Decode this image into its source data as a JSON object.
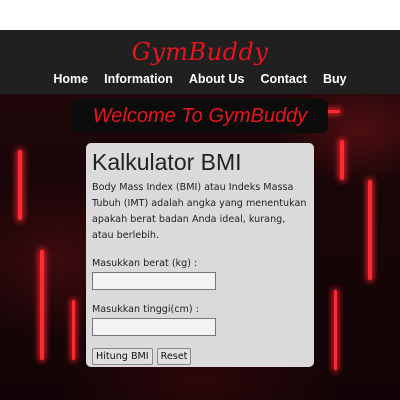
{
  "brand": "GymBuddy",
  "nav": [
    "Home",
    "Information",
    "About Us",
    "Contact",
    "Buy"
  ],
  "welcome": "Welcome To GymBuddy",
  "card": {
    "title": "Kalkulator BMI",
    "description": "Body Mass Index (BMI) atau Indeks Massa Tubuh (IMT) adalah angka yang menentukan apakah berat badan Anda ideal, kurang, atau berlebih.",
    "weight_label": "Masukkan berat (kg) :",
    "height_label": "Masukkan tinggi(cm) :",
    "weight_value": "",
    "height_value": "",
    "calc_button": "Hitung BMI",
    "reset_button": "Reset"
  }
}
